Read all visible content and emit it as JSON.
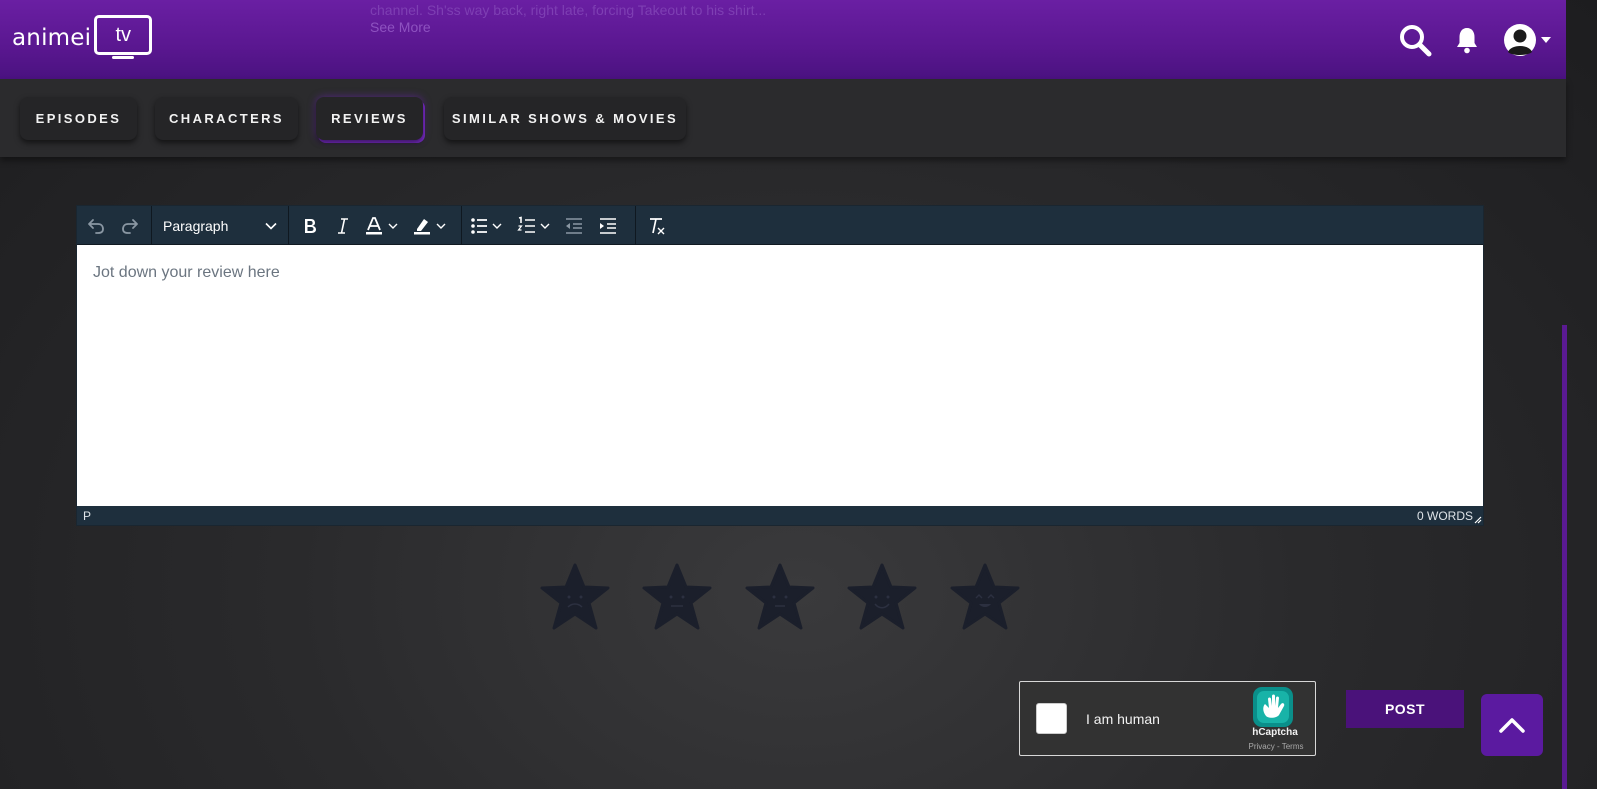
{
  "header": {
    "logo_text": "animei",
    "logo_tv": "tv",
    "peek_text": "channel. Sh'ss way back, right late, forcing Takeout to his shirt...",
    "peek_more": "See More"
  },
  "icons": {
    "search": "search-icon",
    "bell": "bell-icon",
    "avatar": "user-avatar-icon",
    "caret": "caret-down-icon"
  },
  "tabs": [
    {
      "label": "EPISODES",
      "active": false
    },
    {
      "label": "CHARACTERS",
      "active": false
    },
    {
      "label": "REVIEWS",
      "active": true
    },
    {
      "label": "SIMILAR SHOWS & MOVIES",
      "active": false
    }
  ],
  "editor": {
    "block_format": "Paragraph",
    "placeholder": "Jot down your review here",
    "status_path": "P",
    "word_count": "0 WORDS",
    "toolbar_icons": [
      "undo-icon",
      "redo-icon",
      "bold-icon",
      "italic-icon",
      "text-color-icon",
      "highlight-icon",
      "bullet-list-icon",
      "numbered-list-icon",
      "outdent-icon",
      "indent-icon",
      "clear-format-icon"
    ]
  },
  "rating": {
    "stars": [
      "sad-face-star",
      "neutral-face-star",
      "meh-face-star",
      "smile-face-star",
      "happy-face-star"
    ],
    "selected": 0,
    "max": 5,
    "color": "#1b1f2b"
  },
  "captcha": {
    "label": "I am human",
    "brand": "hCaptcha",
    "links": "Privacy - Terms"
  },
  "actions": {
    "post_label": "POST"
  },
  "colors": {
    "brand_purple": "#5a1790",
    "post_button": "#4a127a",
    "toolbar": "#1e2f3d"
  }
}
